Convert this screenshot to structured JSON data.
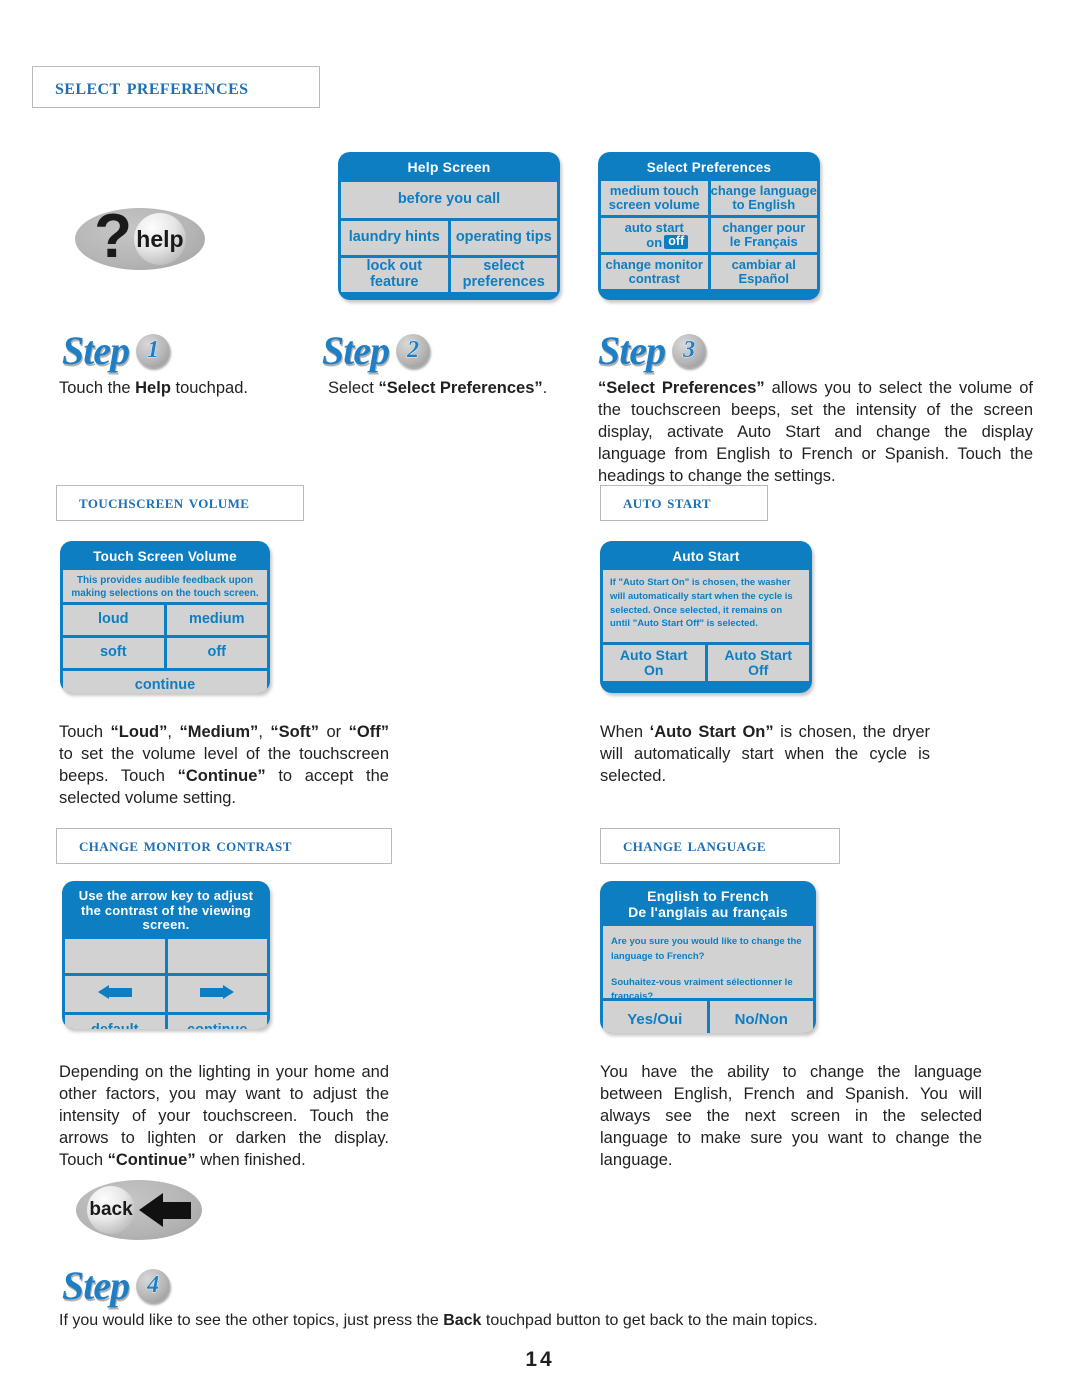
{
  "page": {
    "section_title": "Select Preferences",
    "page_number": "14"
  },
  "touchpads": {
    "help": {
      "symbol": "?",
      "label": "help",
      "name": "help-touchpad"
    },
    "back": {
      "label": "back",
      "name": "back-touchpad"
    }
  },
  "screens": {
    "help_screen": {
      "title": "Help Screen",
      "cells": [
        "before you call",
        "laundry hints",
        "operating tips",
        "lock out\nfeature",
        "select\npreferences"
      ]
    },
    "select_preferences": {
      "title": "Select Preferences",
      "cells": [
        "medium touch\nscreen volume",
        "change language\nto English",
        "auto start\non ",
        "off",
        "change monitor\ncontrast",
        "cambiar al\nEspañol",
        "changer pour\nle Français"
      ]
    },
    "touch_screen_volume": {
      "title": "Touch Screen Volume",
      "info": "This provides audible feedback upon making selections on the touch screen.",
      "buttons": [
        "loud",
        "medium",
        "soft",
        "off",
        "continue"
      ]
    },
    "auto_start": {
      "title": "Auto Start",
      "info": "If \"Auto Start On\" is chosen, the washer will automatically start when the cycle is selected. Once selected, it remains on until \"Auto Start Off\" is selected.",
      "buttons": [
        "Auto Start\nOn",
        "Auto Start\nOff"
      ]
    },
    "change_monitor_contrast": {
      "title": "Use the arrow key to adjust the contrast of the viewing screen.",
      "buttons": [
        "default",
        "continue"
      ],
      "arrow_left": "left-arrow",
      "arrow_right": "right-arrow"
    },
    "change_language": {
      "title_line1": "English to French",
      "title_line2": "De l'anglais au français",
      "info_en": "Are you sure you would like to change the language to French?",
      "info_fr": "Souhaitez-vous vraiment sélectionner le français?",
      "buttons": [
        "Yes/Oui",
        "No/Non"
      ]
    }
  },
  "headings": {
    "touchscreen_volume": "Touchscreen Volume",
    "auto_start": "Auto Start",
    "change_monitor_contrast": "Change Monitor Contrast",
    "change_language": "Change Language"
  },
  "steps": {
    "step_word": "Step",
    "one": {
      "number": "1"
    },
    "two": {
      "number": "2"
    },
    "three": {
      "number": "3"
    },
    "four": {
      "number": "4"
    }
  },
  "body": {
    "step1": {
      "pre": "Touch the ",
      "bold": "Help",
      "post": " touchpad."
    },
    "step2": {
      "pre": "Select ",
      "bold": "“Select Preferences”",
      "post": "."
    },
    "step3": {
      "bold": "“Select Preferences”",
      "post": " allows you to select the volume of the touchscreen beeps, set the intensity of the screen display, activate Auto Start and change the display language from English to French or Spanish. Touch the headings to change the settings."
    },
    "volume_para": {
      "p1": "Touch ",
      "b1": "“Loud”",
      "p2": ", ",
      "b2": "“Medium”",
      "p3": ", ",
      "b3": "“Soft”",
      "p4": " or ",
      "b4": "“Off”",
      "p5": " to set the volume level of the touchscreen beeps. Touch ",
      "b5": "“Continue”",
      "p6": " to accept the selected volume setting."
    },
    "autostart_para": {
      "p1": "When ",
      "b1": "‘Auto Start On”",
      "p2": " is chosen, the dryer will automatically start when the cycle is selected."
    },
    "contrast_para": {
      "p1": "Depending on the lighting in your home and other factors, you may want to adjust the intensity of your touchscreen. Touch the arrows to lighten or darken the display. Touch ",
      "b1": "“Continue”",
      "p2": " when finished."
    },
    "language_para": {
      "p1": "You have the ability to change the language between English, French and Spanish. You will always see the next screen in the selected language to make sure you want to change the language."
    },
    "step4": {
      "p1": "If you would like to see the other topics, just press the ",
      "b1": "Back",
      "p2": " touchpad button to get back to the main topics."
    }
  }
}
